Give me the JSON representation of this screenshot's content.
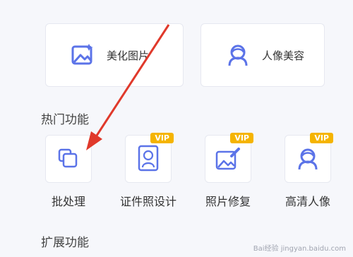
{
  "top_actions": [
    {
      "label": "美化图片",
      "icon": "image-edit-icon"
    },
    {
      "label": "人像美容",
      "icon": "portrait-icon"
    }
  ],
  "sections": {
    "hot": "热门功能",
    "extend": "扩展功能"
  },
  "features": [
    {
      "label": "批处理",
      "icon": "batch-icon",
      "vip": ""
    },
    {
      "label": "证件照设计",
      "icon": "id-photo-icon",
      "vip": "VIP"
    },
    {
      "label": "照片修复",
      "icon": "photo-repair-icon",
      "vip": "VIP"
    },
    {
      "label": "高清人像",
      "icon": "hd-portrait-icon",
      "vip": "VIP"
    }
  ],
  "watermark": "Bai经验 jingyan.baidu.com",
  "colors": {
    "icon": "#5b73e8",
    "vip": "#f5b400",
    "arrow": "#e0392b"
  }
}
